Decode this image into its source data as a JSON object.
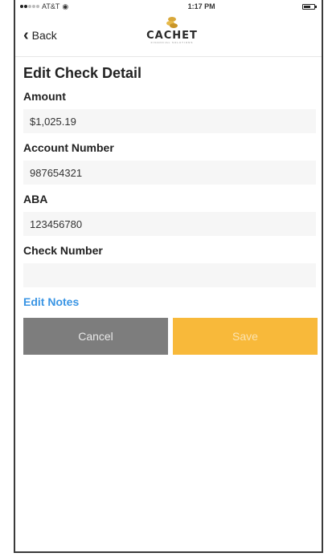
{
  "status_bar": {
    "carrier": "AT&T",
    "wifi_icon": "wifi-icon",
    "time": "1:17 PM",
    "battery_icon": "battery-icon"
  },
  "nav": {
    "back_label": "Back",
    "back_icon": "chevron-left-icon",
    "logo_text": "CACHET",
    "logo_subtext": "FINANCIAL SOLUTIONS"
  },
  "page": {
    "title": "Edit Check Detail"
  },
  "fields": {
    "amount": {
      "label": "Amount",
      "value": "$1,025.19"
    },
    "account_number": {
      "label": "Account Number",
      "value": "987654321"
    },
    "aba": {
      "label": "ABA",
      "value": "123456780"
    },
    "check_number": {
      "label": "Check Number",
      "value": ""
    }
  },
  "links": {
    "edit_notes": "Edit Notes"
  },
  "buttons": {
    "cancel": "Cancel",
    "save": "Save"
  },
  "colors": {
    "accent_blue": "#3a95e4",
    "cancel_gray": "#7d7d7d",
    "save_orange": "#f8b93a"
  }
}
